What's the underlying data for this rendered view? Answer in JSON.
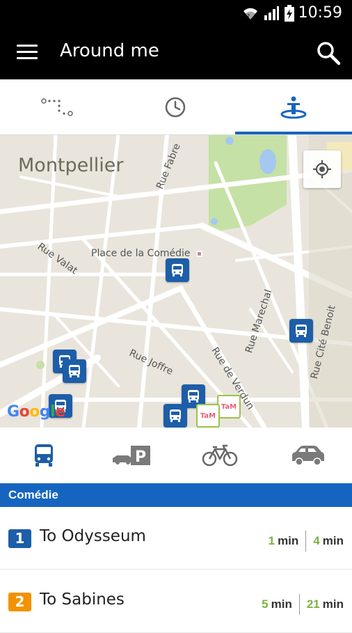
{
  "status": {
    "time": "10:59"
  },
  "app_bar": {
    "title": "Around me"
  },
  "map": {
    "city": "Montpellier",
    "place": "Place de la Comédie",
    "streets": [
      "Rue Fabre",
      "Rue Valat",
      "Rue Joffre",
      "Rue de Verdun",
      "Rue Marechal",
      "Rue Cité Benoit"
    ],
    "attribution": "Google",
    "tam_label": "TaM"
  },
  "stop": {
    "name": "Comédie"
  },
  "lines": [
    {
      "number": "1",
      "destination": "To Odysseum",
      "color": "#1d5ea8",
      "times": [
        "1",
        "4"
      ],
      "unit": "min"
    },
    {
      "number": "2",
      "destination": "To Sabines",
      "color": "#f39200",
      "times": [
        "5",
        "21"
      ],
      "unit": "min"
    }
  ],
  "colors": {
    "accent": "#1565c0",
    "time_green": "#7cb342"
  }
}
